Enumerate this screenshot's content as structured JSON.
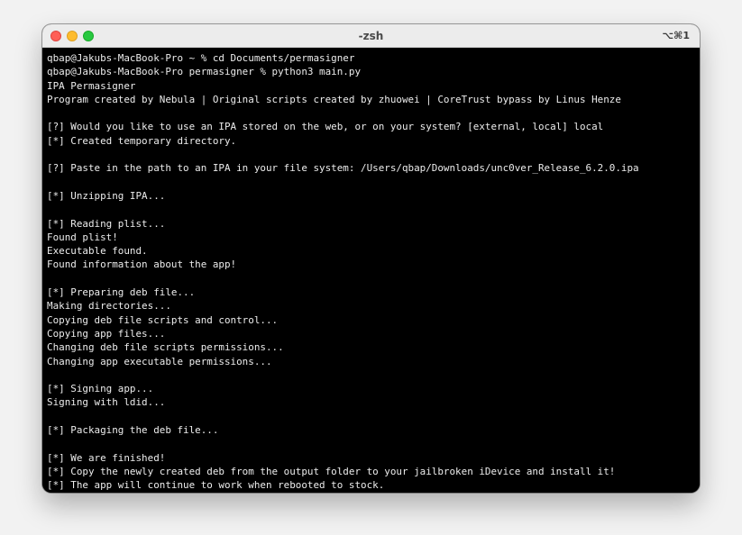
{
  "window": {
    "title": "-zsh",
    "shortcut": "⌥⌘1"
  },
  "terminal": {
    "lines": [
      "qbap@Jakubs-MacBook-Pro ~ % cd Documents/permasigner",
      "qbap@Jakubs-MacBook-Pro permasigner % python3 main.py",
      "IPA Permasigner",
      "Program created by Nebula | Original scripts created by zhuowei | CoreTrust bypass by Linus Henze",
      "",
      "[?] Would you like to use an IPA stored on the web, or on your system? [external, local] local",
      "[*] Created temporary directory.",
      "",
      "[?] Paste in the path to an IPA in your file system: /Users/qbap/Downloads/unc0ver_Release_6.2.0.ipa",
      "",
      "[*] Unzipping IPA...",
      "",
      "[*] Reading plist...",
      "Found plist!",
      "Executable found.",
      "Found information about the app!",
      "",
      "[*] Preparing deb file...",
      "Making directories...",
      "Copying deb file scripts and control...",
      "Copying app files...",
      "Changing deb file scripts permissions...",
      "Changing app executable permissions...",
      "",
      "[*] Signing app...",
      "Signing with ldid...",
      "",
      "[*] Packaging the deb file...",
      "",
      "[*] We are finished!",
      "[*] Copy the newly created deb from the output folder to your jailbroken iDevice and install it!",
      "[*] The app will continue to work when rebooted to stock."
    ]
  }
}
